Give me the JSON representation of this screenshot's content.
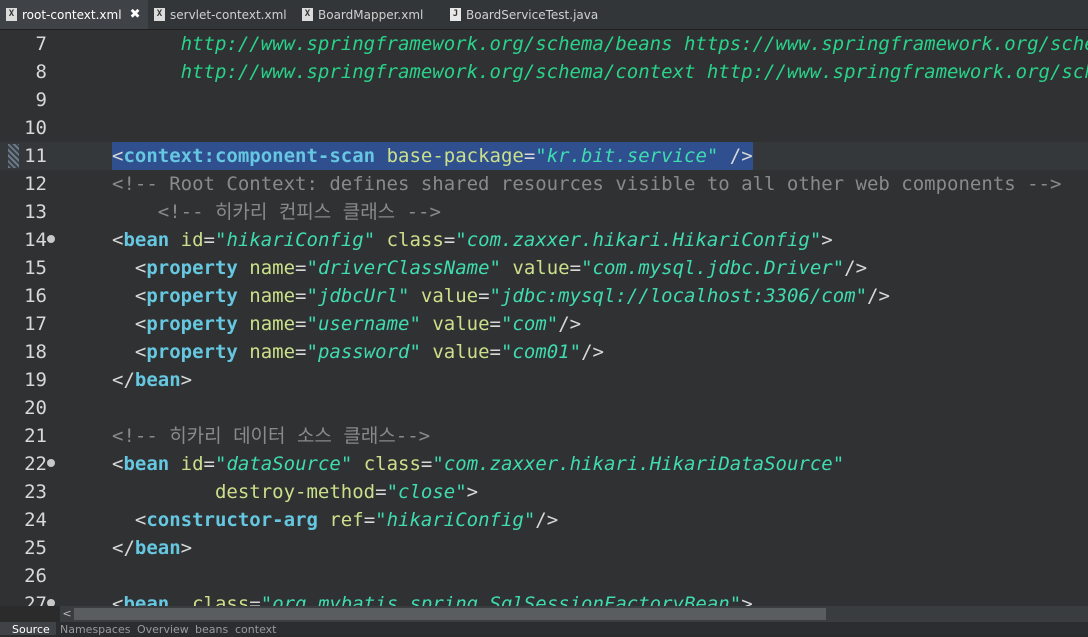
{
  "tabs": [
    {
      "label": "root-context.xml",
      "icon": "xml-file-icon",
      "active": true,
      "close": "✖"
    },
    {
      "label": "servlet-context.xml",
      "icon": "xml-file-icon",
      "active": false
    },
    {
      "label": "BoardMapper.xml",
      "icon": "xml-file-icon",
      "active": false
    },
    {
      "label": "BoardServiceTest.java",
      "icon": "java-file-icon",
      "active": false
    }
  ],
  "editor": {
    "lines": [
      {
        "num": "7",
        "code": [
          {
            "t": "url",
            "s": "      http://www.springframework.org/schema/beans https://www.springframework.org/schema/beans/spring-beans.xsd"
          }
        ]
      },
      {
        "num": "8",
        "code": [
          {
            "t": "url",
            "s": "      http://www.springframework.org/schema/context http://www.springframework.org/schema/context/spring-context.xsd\">"
          }
        ]
      },
      {
        "num": "9",
        "code": []
      },
      {
        "num": "10",
        "code": []
      },
      {
        "num": "11",
        "current": true,
        "code": [
          {
            "t": "br",
            "s": "<"
          },
          {
            "t": "tag",
            "s": "context:component-scan"
          },
          {
            "t": "attr",
            "s": " base-package"
          },
          {
            "t": "br",
            "s": "="
          },
          {
            "t": "str",
            "s": "\"kr.bit.service\""
          },
          {
            "t": "br",
            "s": " />"
          }
        ]
      },
      {
        "num": "12",
        "code": [
          {
            "t": "com",
            "s": "<!-- Root Context: defines shared resources visible to all other web components -->"
          }
        ]
      },
      {
        "num": "13",
        "code": [
          {
            "t": "com",
            "s": "    <!-- 히카리 컨피스 클래스 -->"
          }
        ]
      },
      {
        "num": "14",
        "fold": true,
        "code": [
          {
            "t": "br",
            "s": "<"
          },
          {
            "t": "tag",
            "s": "bean"
          },
          {
            "t": "attr",
            "s": " id"
          },
          {
            "t": "br",
            "s": "="
          },
          {
            "t": "str",
            "s": "\"hikariConfig\""
          },
          {
            "t": "attr",
            "s": " class"
          },
          {
            "t": "br",
            "s": "="
          },
          {
            "t": "str",
            "s": "\"com.zaxxer.hikari.HikariConfig\""
          },
          {
            "t": "br",
            "s": ">"
          }
        ]
      },
      {
        "num": "15",
        "code": [
          {
            "t": "br",
            "s": "  <"
          },
          {
            "t": "tag",
            "s": "property"
          },
          {
            "t": "attr",
            "s": " name"
          },
          {
            "t": "br",
            "s": "="
          },
          {
            "t": "str",
            "s": "\"driverClassName\""
          },
          {
            "t": "attr",
            "s": " value"
          },
          {
            "t": "br",
            "s": "="
          },
          {
            "t": "str",
            "s": "\"com.mysql.jdbc.Driver\""
          },
          {
            "t": "br",
            "s": "/>"
          }
        ]
      },
      {
        "num": "16",
        "code": [
          {
            "t": "br",
            "s": "  <"
          },
          {
            "t": "tag",
            "s": "property"
          },
          {
            "t": "attr",
            "s": " name"
          },
          {
            "t": "br",
            "s": "="
          },
          {
            "t": "str",
            "s": "\"jdbcUrl\""
          },
          {
            "t": "attr",
            "s": " value"
          },
          {
            "t": "br",
            "s": "="
          },
          {
            "t": "str",
            "s": "\"jdbc:mysql://localhost:3306/com\""
          },
          {
            "t": "br",
            "s": "/>"
          }
        ]
      },
      {
        "num": "17",
        "code": [
          {
            "t": "br",
            "s": "  <"
          },
          {
            "t": "tag",
            "s": "property"
          },
          {
            "t": "attr",
            "s": " name"
          },
          {
            "t": "br",
            "s": "="
          },
          {
            "t": "str",
            "s": "\"username\""
          },
          {
            "t": "attr",
            "s": " value"
          },
          {
            "t": "br",
            "s": "="
          },
          {
            "t": "str",
            "s": "\"com\""
          },
          {
            "t": "br",
            "s": "/>"
          }
        ]
      },
      {
        "num": "18",
        "code": [
          {
            "t": "br",
            "s": "  <"
          },
          {
            "t": "tag",
            "s": "property"
          },
          {
            "t": "attr",
            "s": " name"
          },
          {
            "t": "br",
            "s": "="
          },
          {
            "t": "str",
            "s": "\"password\""
          },
          {
            "t": "attr",
            "s": " value"
          },
          {
            "t": "br",
            "s": "="
          },
          {
            "t": "str",
            "s": "\"com01\""
          },
          {
            "t": "br",
            "s": "/>"
          }
        ]
      },
      {
        "num": "19",
        "code": [
          {
            "t": "br",
            "s": "</"
          },
          {
            "t": "tag",
            "s": "bean"
          },
          {
            "t": "br",
            "s": ">"
          }
        ]
      },
      {
        "num": "20",
        "code": []
      },
      {
        "num": "21",
        "code": [
          {
            "t": "com",
            "s": "<!-- 히카리 데이터 소스 클래스-->"
          }
        ]
      },
      {
        "num": "22",
        "fold": true,
        "code": [
          {
            "t": "br",
            "s": "<"
          },
          {
            "t": "tag",
            "s": "bean"
          },
          {
            "t": "attr",
            "s": " id"
          },
          {
            "t": "br",
            "s": "="
          },
          {
            "t": "str",
            "s": "\"dataSource\""
          },
          {
            "t": "attr",
            "s": " class"
          },
          {
            "t": "br",
            "s": "="
          },
          {
            "t": "str",
            "s": "\"com.zaxxer.hikari.HikariDataSource\""
          }
        ]
      },
      {
        "num": "23",
        "code": [
          {
            "t": "attr",
            "s": "         destroy-method"
          },
          {
            "t": "br",
            "s": "="
          },
          {
            "t": "str",
            "s": "\"close\""
          },
          {
            "t": "br",
            "s": ">"
          }
        ]
      },
      {
        "num": "24",
        "code": [
          {
            "t": "br",
            "s": "  <"
          },
          {
            "t": "tag",
            "s": "constructor-arg"
          },
          {
            "t": "attr",
            "s": " ref"
          },
          {
            "t": "br",
            "s": "="
          },
          {
            "t": "str",
            "s": "\"hikariConfig\""
          },
          {
            "t": "br",
            "s": "/>"
          }
        ]
      },
      {
        "num": "25",
        "code": [
          {
            "t": "br",
            "s": "</"
          },
          {
            "t": "tag",
            "s": "bean"
          },
          {
            "t": "br",
            "s": ">"
          }
        ]
      },
      {
        "num": "26",
        "code": []
      },
      {
        "num": "27",
        "fold": true,
        "code": [
          {
            "t": "br",
            "s": "<"
          },
          {
            "t": "tag",
            "s": "bean"
          },
          {
            "t": "attr",
            "s": "  class"
          },
          {
            "t": "br",
            "s": "="
          },
          {
            "t": "str",
            "s": "\"org.mybatis.spring.SqlSessionFactoryBean\""
          },
          {
            "t": "br",
            "s": ">"
          }
        ]
      }
    ]
  },
  "scrollbar": {
    "left_arrow": "<"
  },
  "bottom_tabs": [
    {
      "label": "Source",
      "active": true
    },
    {
      "label": "Namespaces",
      "active": false
    },
    {
      "label": "Overview",
      "active": false
    },
    {
      "label": "beans",
      "active": false
    },
    {
      "label": "context",
      "active": false
    }
  ],
  "colors": {
    "tag": "#66c7e0",
    "attribute": "#cbe08a",
    "string": "#3fdcb0",
    "url": "#29d38a",
    "comment": "#8a8a8a",
    "selection": "#2f4f8f"
  }
}
